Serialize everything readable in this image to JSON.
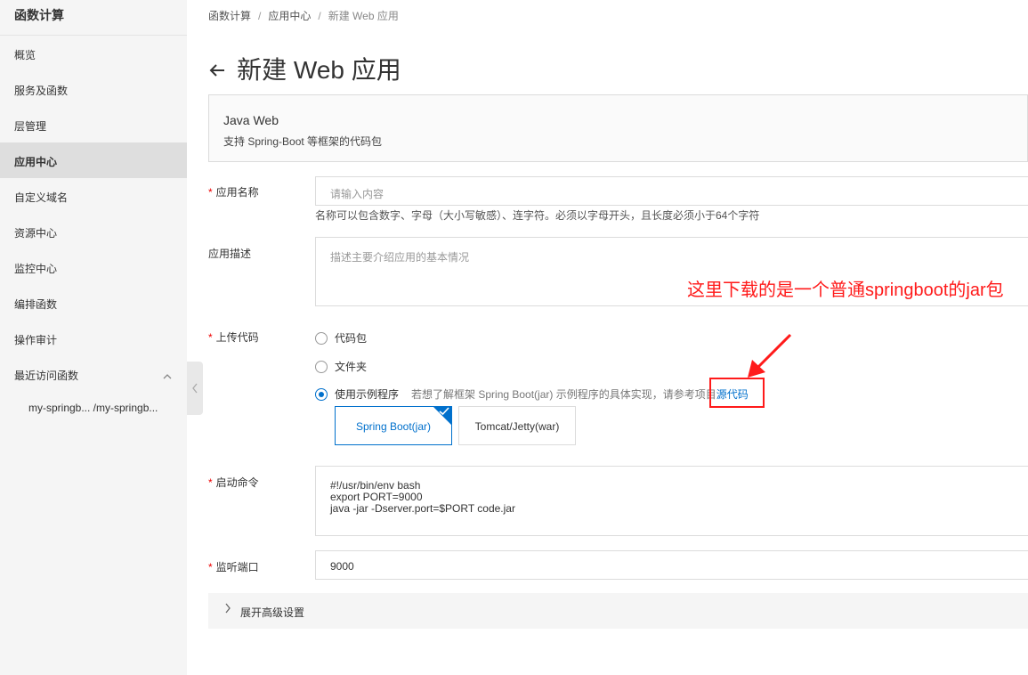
{
  "sidebar": {
    "title": "函数计算",
    "items": [
      {
        "label": "概览"
      },
      {
        "label": "服务及函数"
      },
      {
        "label": "层管理"
      },
      {
        "label": "应用中心"
      },
      {
        "label": "自定义域名"
      },
      {
        "label": "资源中心"
      },
      {
        "label": "监控中心"
      },
      {
        "label": "编排函数"
      },
      {
        "label": "操作审计"
      },
      {
        "label": "最近访问函数"
      }
    ],
    "active_index": 3,
    "recent_item": "my-springb... /my-springb..."
  },
  "breadcrumb": {
    "items": [
      "函数计算",
      "应用中心",
      "新建 Web 应用"
    ],
    "separator": "/"
  },
  "page": {
    "title": "新建 Web 应用",
    "back_icon": "arrow-left-icon"
  },
  "template_card": {
    "title": "Java Web",
    "description": "支持 Spring-Boot 等框架的代码包"
  },
  "form": {
    "app_name": {
      "label": "应用名称",
      "placeholder": "请输入内容",
      "value": "",
      "hint": "名称可以包含数字、字母（大小写敏感）、连字符。必须以字母开头，且长度必须小于64个字符"
    },
    "app_desc": {
      "label": "应用描述",
      "placeholder": "描述主要介绍应用的基本情况"
    },
    "upload": {
      "label": "上传代码",
      "options": [
        "代码包",
        "文件夹",
        "使用示例程序"
      ],
      "selected": "使用示例程序",
      "sample_desc": "若想了解框架 Spring Boot(jar) 示例程序的具体实现，请参考项目",
      "sample_link": "源代码",
      "sample_types": [
        "Spring Boot(jar)",
        "Tomcat/Jetty(war)"
      ],
      "selected_type": "Spring Boot(jar)"
    },
    "start_cmd": {
      "label": "启动命令",
      "lines": [
        "#!/usr/bin/env bash",
        "export PORT=9000",
        "java -jar -Dserver.port=$PORT code.jar"
      ]
    },
    "port": {
      "label": "监听端口",
      "value": "9000"
    },
    "advanced": {
      "label": "展开高级设置"
    }
  },
  "annotation": {
    "text": "这里下载的是一个普通springboot的jar包",
    "color": "#ff1a1a"
  },
  "colors": {
    "accent": "#0070cc",
    "required": "#ee0000"
  }
}
